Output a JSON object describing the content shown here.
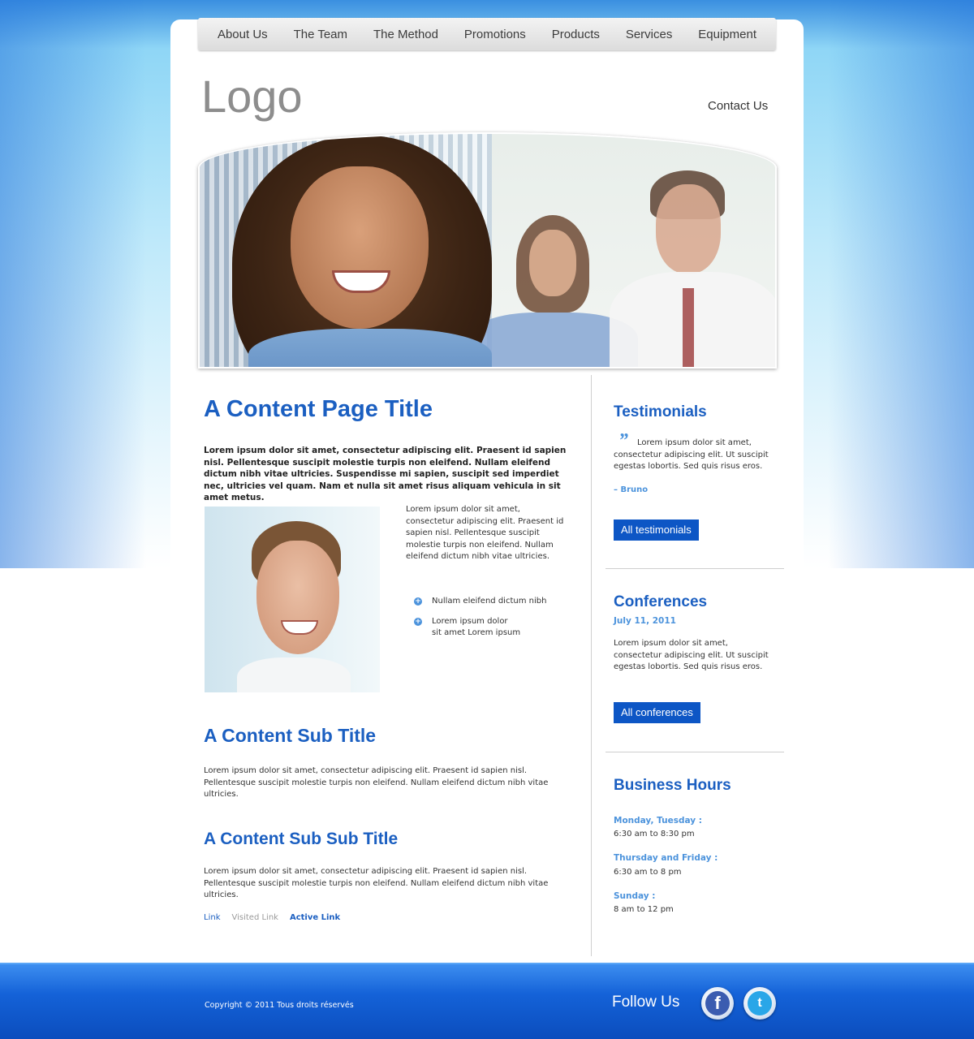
{
  "nav": {
    "items": [
      "About Us",
      "The Team",
      "The Method",
      "Promotions",
      "Products",
      "Services",
      "Equipment"
    ]
  },
  "header": {
    "logo": "Logo",
    "contact": "Contact Us"
  },
  "main": {
    "title": "A Content Page Title",
    "intro": "Lorem ipsum dolor sit amet, consectetur adipiscing elit. Praesent id sapien nisl. Pellentesque suscipit molestie turpis non eleifend. Nullam eleifend dictum nibh vitae ultricies. Suspendisse mi sapien, suscipit sed imperdiet nec, ultricies vel quam. Nam et nulla sit amet risus aliquam vehicula in sit amet metus.",
    "side_paragraph": "Lorem ipsum dolor sit amet, consectetur adipiscing elit. Praesent id sapien nisl. Pellentesque suscipit molestie turpis non eleifend. Nullam eleifend dictum nibh vitae ultricies.",
    "bullets": [
      "Nullam eleifend dictum nibh",
      "Lorem ipsum dolor\nsit amet Lorem ipsum"
    ],
    "sub_title": "A Content Sub Title",
    "sub_paragraph": "Lorem ipsum dolor sit amet, consectetur adipiscing elit. Praesent id sapien nisl. Pellentesque suscipit molestie turpis non eleifend. Nullam eleifend dictum nibh vitae ultricies.",
    "sub_sub_title": "A Content Sub Sub Title",
    "sub_sub_paragraph": "Lorem ipsum dolor sit amet, consectetur adipiscing elit. Praesent id sapien nisl. Pellentesque suscipit molestie turpis non eleifend. Nullam eleifend dictum nibh vitae ultricies.",
    "links": {
      "link": "Link",
      "visited": "Visited Link",
      "active": "Active Link"
    }
  },
  "sidebar": {
    "testimonials": {
      "title": "Testimonials",
      "quote_mark": "”",
      "text": "Lorem ipsum dolor sit amet, consectetur adipiscing elit. Ut suscipit egestas lobortis. Sed quis risus eros.",
      "author": "– Bruno",
      "button": "All testimonials"
    },
    "conferences": {
      "title": "Conferences",
      "date": "July 11, 2011",
      "text": "Lorem ipsum dolor sit amet, consectetur adipiscing elit. Ut suscipit egestas lobortis. Sed quis risus eros.",
      "button": "All conferences"
    },
    "hours": {
      "title": "Business Hours",
      "entries": [
        {
          "label": "Monday, Tuesday :",
          "value": "6:30 am to 8:30 pm"
        },
        {
          "label": "Thursday and Friday :",
          "value": "6:30 am to 8 pm"
        },
        {
          "label": "Sunday :",
          "value": "8 am to 12 pm"
        }
      ]
    }
  },
  "footer": {
    "copyright": "Copyright © 2011 Tous droits réservés",
    "follow": "Follow Us",
    "facebook_glyph": "f",
    "twitter_glyph": "t"
  },
  "colors": {
    "accent": "#1b5fc1",
    "light_accent": "#4c93dc",
    "button": "#0d56c5",
    "footer": "#1462d8"
  }
}
